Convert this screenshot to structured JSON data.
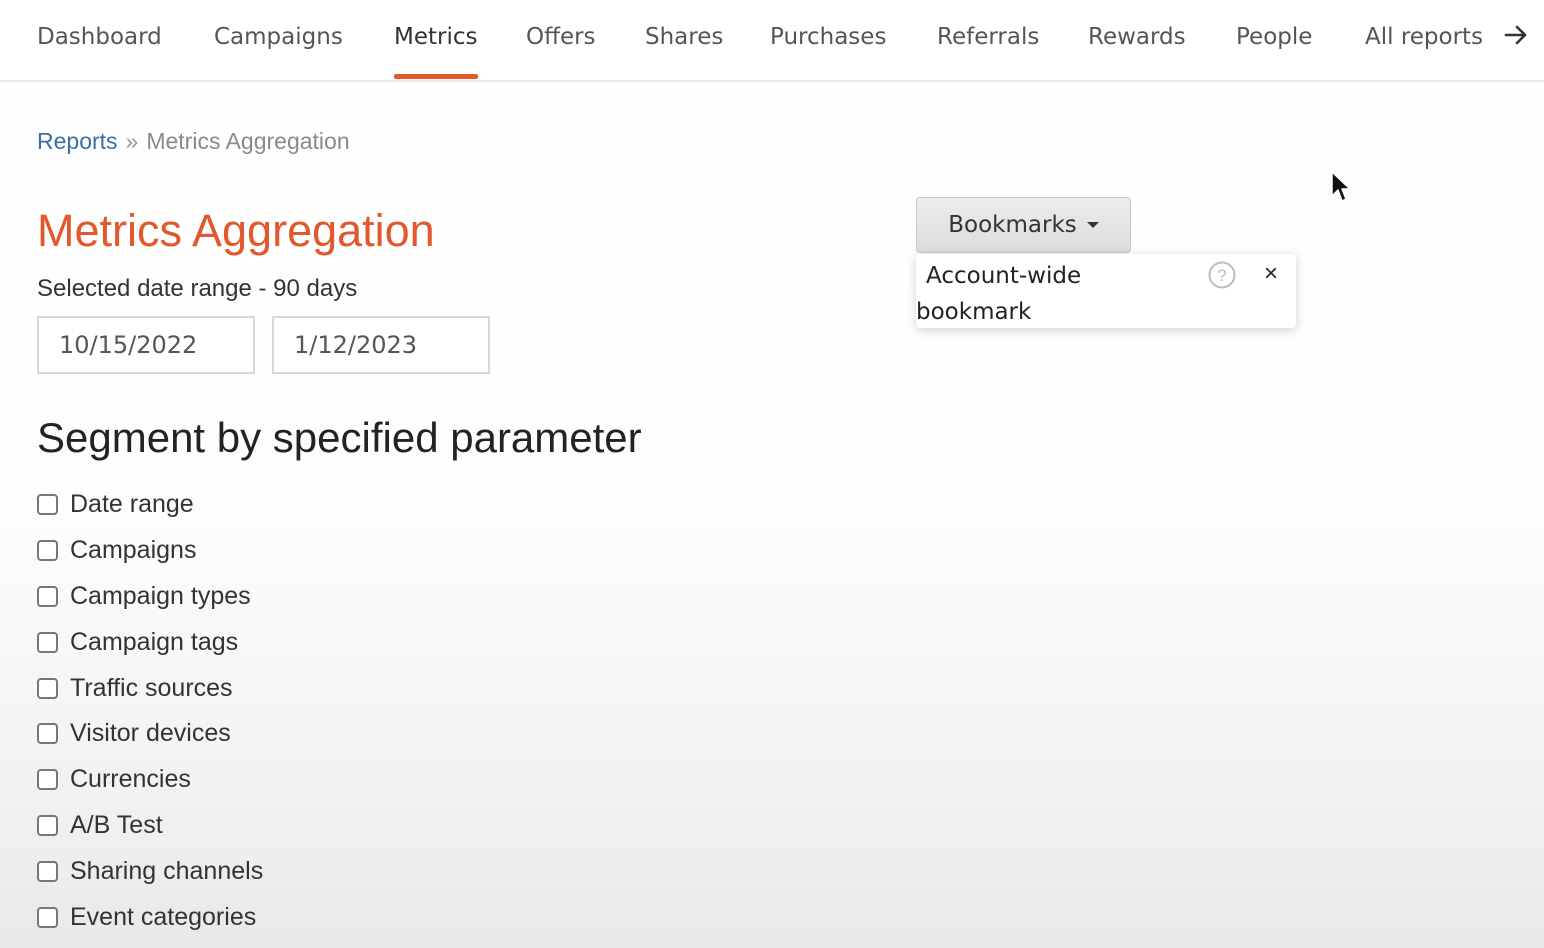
{
  "nav": {
    "tabs": [
      {
        "label": "Dashboard"
      },
      {
        "label": "Campaigns"
      },
      {
        "label": "Metrics",
        "active": true
      },
      {
        "label": "Offers"
      },
      {
        "label": "Shares"
      },
      {
        "label": "Purchases"
      },
      {
        "label": "Referrals"
      },
      {
        "label": "Rewards"
      },
      {
        "label": "People"
      },
      {
        "label": "All reports",
        "icon": "arrow-right-icon"
      }
    ],
    "active_color": "#e2572b"
  },
  "breadcrumb": {
    "link": "Reports",
    "separator": "»",
    "current": "Metrics Aggregation"
  },
  "page": {
    "title": "Metrics Aggregation",
    "title_color": "#e2572b",
    "date_range_label": "Selected date range - 90 days",
    "start_date": "10/15/2022",
    "end_date": "1/12/2023"
  },
  "segment": {
    "title": "Segment by specified parameter",
    "options": [
      {
        "label": "Date range",
        "checked": false
      },
      {
        "label": "Campaigns",
        "checked": false
      },
      {
        "label": "Campaign types",
        "checked": false
      },
      {
        "label": "Campaign tags",
        "checked": false
      },
      {
        "label": "Traffic sources",
        "checked": false
      },
      {
        "label": "Visitor devices",
        "checked": false
      },
      {
        "label": "Currencies",
        "checked": false
      },
      {
        "label": "A/B Test",
        "checked": false
      },
      {
        "label": "Sharing channels",
        "checked": false
      },
      {
        "label": "Event categories",
        "checked": false
      }
    ]
  },
  "bookmarks": {
    "button_label": "Bookmarks",
    "popup_text": "Account-wide bookmark",
    "help_icon": "question-circle-icon",
    "close_label": "×"
  }
}
